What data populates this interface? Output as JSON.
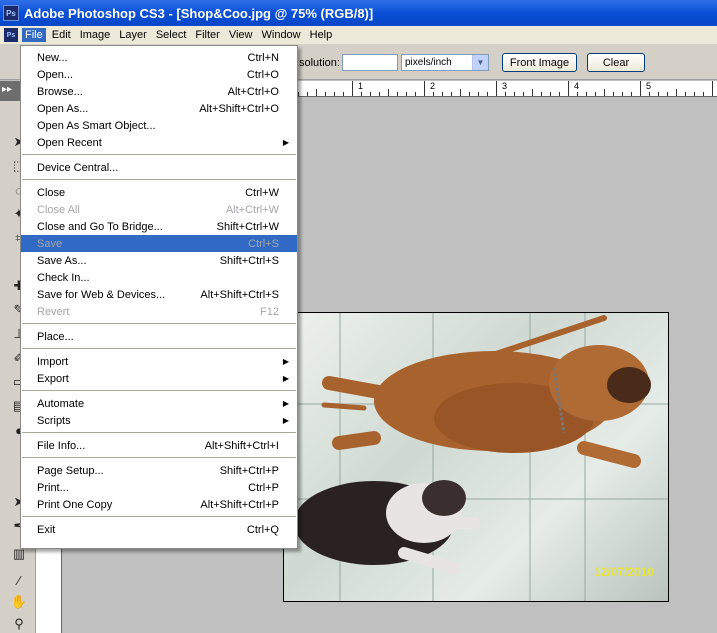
{
  "window": {
    "title": "Adobe Photoshop CS3 - [Shop&Coo.jpg @ 75% (RGB/8)]",
    "app_icon": "Ps"
  },
  "menubar": {
    "items": [
      {
        "label": "File"
      },
      {
        "label": "Edit"
      },
      {
        "label": "Image"
      },
      {
        "label": "Layer"
      },
      {
        "label": "Select"
      },
      {
        "label": "Filter"
      },
      {
        "label": "View"
      },
      {
        "label": "Window"
      },
      {
        "label": "Help"
      }
    ]
  },
  "options": {
    "resolution_label": "solution:",
    "resolution_value": "",
    "units_value": "pixels/inch",
    "front_image_label": "Front Image",
    "clear_label": "Clear"
  },
  "ruler": {
    "numbers": [
      "1",
      "2",
      "3",
      "4",
      "5"
    ]
  },
  "photo": {
    "date_stamp": "12/07/2010"
  },
  "file_menu": {
    "groups": [
      [
        {
          "label": "New...",
          "shortcut": "Ctrl+N"
        },
        {
          "label": "Open...",
          "shortcut": "Ctrl+O"
        },
        {
          "label": "Browse...",
          "shortcut": "Alt+Ctrl+O"
        },
        {
          "label": "Open As...",
          "shortcut": "Alt+Shift+Ctrl+O"
        },
        {
          "label": "Open As Smart Object...",
          "shortcut": ""
        },
        {
          "label": "Open Recent",
          "shortcut": "",
          "submenu": true
        }
      ],
      [
        {
          "label": "Device Central...",
          "shortcut": ""
        }
      ],
      [
        {
          "label": "Close",
          "shortcut": "Ctrl+W"
        },
        {
          "label": "Close All",
          "shortcut": "Alt+Ctrl+W",
          "disabled": true
        },
        {
          "label": "Close and Go To Bridge...",
          "shortcut": "Shift+Ctrl+W"
        },
        {
          "label": "Save",
          "shortcut": "Ctrl+S",
          "disabled": true,
          "highlight": true
        },
        {
          "label": "Save As...",
          "shortcut": "Shift+Ctrl+S"
        },
        {
          "label": "Check In...",
          "shortcut": ""
        },
        {
          "label": "Save for Web & Devices...",
          "shortcut": "Alt+Shift+Ctrl+S"
        },
        {
          "label": "Revert",
          "shortcut": "F12",
          "disabled": true
        }
      ],
      [
        {
          "label": "Place...",
          "shortcut": ""
        }
      ],
      [
        {
          "label": "Import",
          "shortcut": "",
          "submenu": true
        },
        {
          "label": "Export",
          "shortcut": "",
          "submenu": true
        }
      ],
      [
        {
          "label": "Automate",
          "shortcut": "",
          "submenu": true
        },
        {
          "label": "Scripts",
          "shortcut": "",
          "submenu": true
        }
      ],
      [
        {
          "label": "File Info...",
          "shortcut": "Alt+Shift+Ctrl+I"
        }
      ],
      [
        {
          "label": "Page Setup...",
          "shortcut": "Shift+Ctrl+P"
        },
        {
          "label": "Print...",
          "shortcut": "Ctrl+P"
        },
        {
          "label": "Print One Copy",
          "shortcut": "Alt+Shift+Ctrl+P"
        }
      ],
      [
        {
          "label": "Exit",
          "shortcut": "Ctrl+Q"
        }
      ]
    ]
  }
}
